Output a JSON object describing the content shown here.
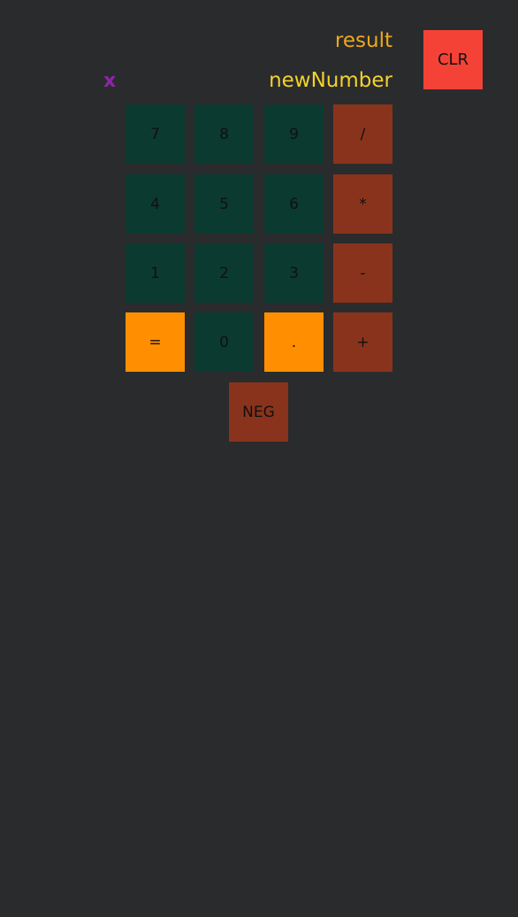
{
  "display": {
    "result": "result",
    "new_number": "newNumber",
    "operation": "x"
  },
  "buttons": {
    "clear": "CLR",
    "seven": "7",
    "eight": "8",
    "nine": "9",
    "divide": "/",
    "four": "4",
    "five": "5",
    "six": "6",
    "multiply": "*",
    "one": "1",
    "two": "2",
    "three": "3",
    "minus": "-",
    "equals": "=",
    "zero": "0",
    "dot": ".",
    "plus": "+",
    "neg": "NEG"
  },
  "colors": {
    "background": "#2a2b2d",
    "result_text": "#f0a81c",
    "new_number_text": "#f2d22e",
    "operation_text": "#8e24aa",
    "digit_button": "#0b3a30",
    "operator_button": "#8a331c",
    "accent_button": "#ff8f00",
    "clear_button": "#f44336"
  }
}
